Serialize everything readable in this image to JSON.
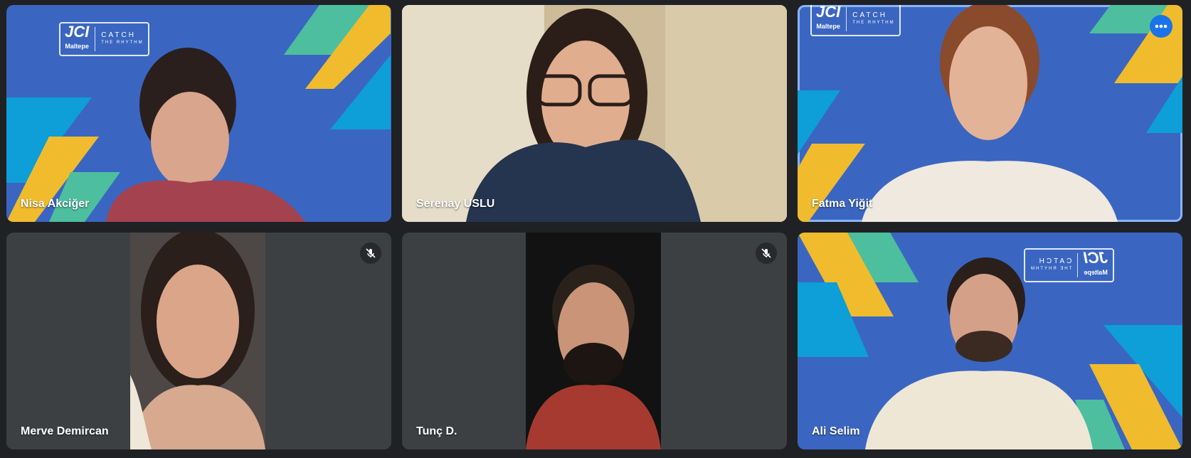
{
  "participants": [
    {
      "name": "Nisa Akciğer",
      "background": "jci-blue",
      "muted": false
    },
    {
      "name": "Serenay USLU",
      "background": "room",
      "muted": false
    },
    {
      "name": "Fatma Yiğit",
      "background": "jci-blue",
      "muted": false,
      "speaking": true,
      "menu": "more-options-icon"
    },
    {
      "name": "Merve Demircan",
      "background": "portrait",
      "muted": true
    },
    {
      "name": "Tunç D.",
      "background": "portrait",
      "muted": true
    },
    {
      "name": "Ali Selim",
      "background": "jci-blue-mirrored",
      "muted": false
    }
  ],
  "logo": {
    "brand": "JCI",
    "chapter": "Maltepe",
    "slogan": "CATCH",
    "slogan_sub": "THE RHYTHM"
  },
  "colors": {
    "tile_bg": "#3c4043",
    "jci_blue": "#3a66c1",
    "accent_yellow": "#f0bc2d",
    "accent_green": "#4dbf9e",
    "accent_cyan": "#0e9ed8",
    "speaking_border": "#8ab4f8"
  }
}
